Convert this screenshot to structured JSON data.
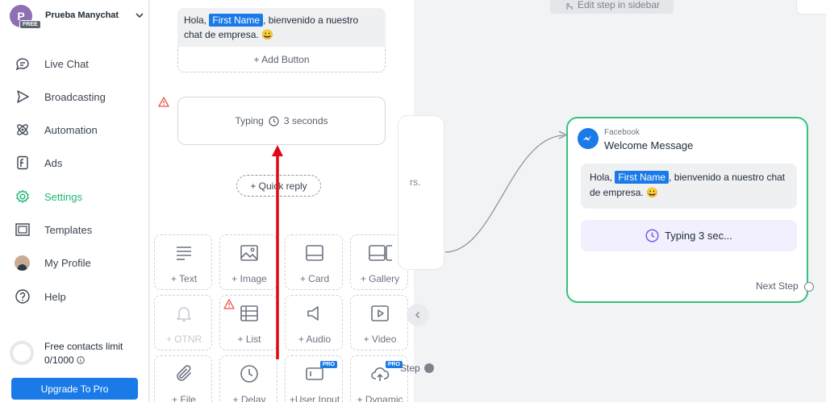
{
  "account": {
    "avatar_letter": "P",
    "badge": "FREE",
    "name": "Prueba Manychat"
  },
  "nav": {
    "items": [
      {
        "label": "Live Chat",
        "icon": "chat-bubble-icon"
      },
      {
        "label": "Broadcasting",
        "icon": "send-icon"
      },
      {
        "label": "Automation",
        "icon": "atom-icon"
      },
      {
        "label": "Ads",
        "icon": "ads-icon"
      },
      {
        "label": "Settings",
        "icon": "gear-icon",
        "active": true
      },
      {
        "label": "Templates",
        "icon": "templates-icon"
      },
      {
        "label": "My Profile",
        "icon": "profile-avatar"
      },
      {
        "label": "Help",
        "icon": "help-icon"
      }
    ],
    "contacts_label": "Free contacts limit",
    "contacts_count": "0/1000",
    "upgrade_label": "Upgrade To Pro",
    "active_color": "#22b573",
    "upgrade_color": "#1a7ae8"
  },
  "editor": {
    "message": {
      "before": "Hola, ",
      "chip": "First Name",
      "after": ", bienvenido a nuestro chat de empresa. 😀"
    },
    "add_button": "+ Add Button",
    "typing": {
      "label": "Typing",
      "duration": "3 seconds"
    },
    "quick_reply": "+ Quick reply",
    "tiles": [
      {
        "label": "+ Text",
        "icon": "text-lines-icon"
      },
      {
        "label": "+ Image",
        "icon": "image-icon"
      },
      {
        "label": "+ Card",
        "icon": "card-icon"
      },
      {
        "label": "+ Gallery",
        "icon": "gallery-icon"
      },
      {
        "label": "+ OTNR",
        "icon": "bell-icon",
        "disabled": true
      },
      {
        "label": "+ List",
        "icon": "list-icon",
        "warning": true
      },
      {
        "label": "+ Audio",
        "icon": "speaker-icon"
      },
      {
        "label": "+ Video",
        "icon": "video-icon"
      },
      {
        "label": "+ File",
        "icon": "paperclip-icon"
      },
      {
        "label": "+ Delay",
        "icon": "clock-icon"
      },
      {
        "label": "+User Input",
        "icon": "input-icon",
        "pro": "PRO"
      },
      {
        "label": "+ Dynamic",
        "icon": "cloud-icon",
        "pro": "PRO"
      }
    ]
  },
  "canvas": {
    "hint": "Edit step in sidebar",
    "prev_node_text": "rs.",
    "prev_step_label": "Step",
    "node": {
      "source": "Facebook",
      "title": "Welcome Message",
      "message": {
        "before": "Hola, ",
        "chip": "First Name",
        "after": ", bienvenido a nuestro chat de empresa. 😀"
      },
      "typing": "Typing 3 sec...",
      "next_step": "Next Step"
    },
    "node_border_color": "#34c27a",
    "chip_color": "#1a7ae8",
    "annotation_arrow_color": "#e30613"
  }
}
